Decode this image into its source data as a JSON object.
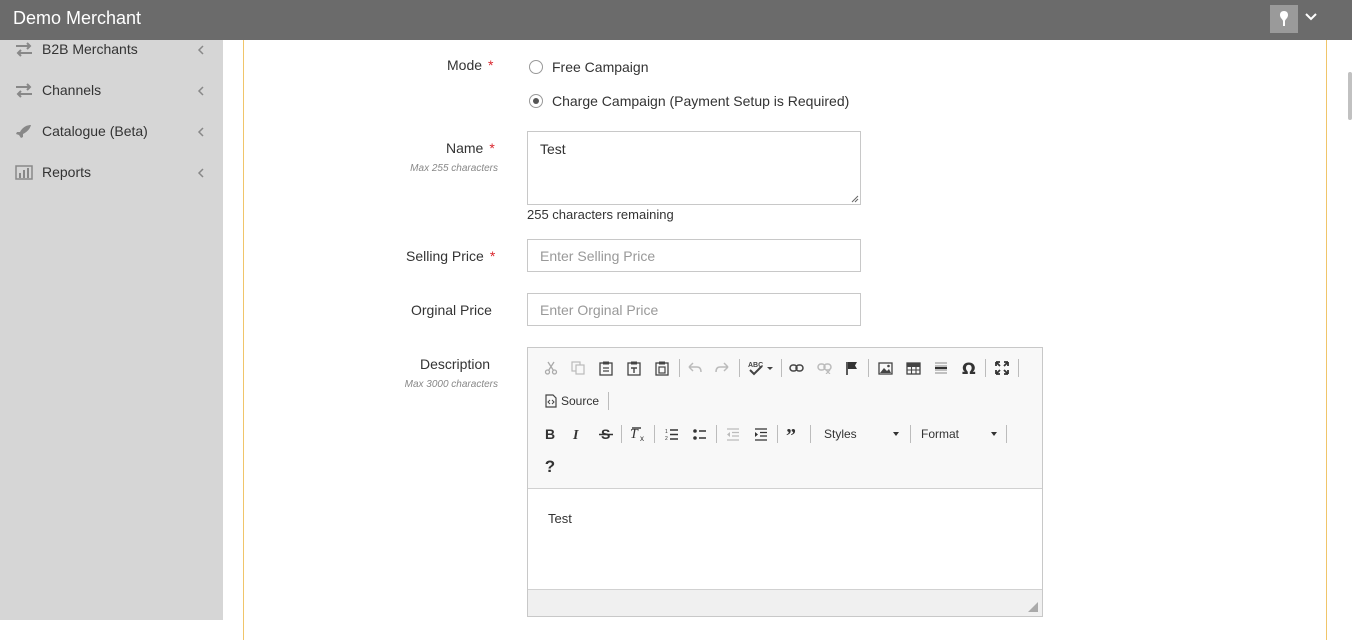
{
  "app": {
    "title": "Demo Merchant"
  },
  "sidebar": {
    "items": [
      {
        "label": "B2B Merchants",
        "icon": "exchange-icon"
      },
      {
        "label": "Channels",
        "icon": "exchange-icon"
      },
      {
        "label": "Catalogue (Beta)",
        "icon": "rocket-icon"
      },
      {
        "label": "Reports",
        "icon": "bar-chart-icon"
      }
    ]
  },
  "form": {
    "mode": {
      "label": "Mode",
      "required_mark": "*",
      "options": [
        {
          "label": "Free Campaign",
          "selected": false
        },
        {
          "label": "Charge Campaign (Payment Setup is Required)",
          "selected": true
        }
      ]
    },
    "name": {
      "label": "Name",
      "required_mark": "*",
      "hint": "Max 255 characters",
      "value": "Test",
      "remaining": "255 characters remaining"
    },
    "selling_price": {
      "label": "Selling Price",
      "required_mark": "*",
      "placeholder": "Enter Selling Price"
    },
    "original_price": {
      "label": "Orginal Price",
      "placeholder": "Enter Orginal Price"
    },
    "description": {
      "label": "Description",
      "hint": "Max 3000 characters",
      "body": "Test",
      "toolbar": {
        "source_label": "Source",
        "styles_label": "Styles",
        "format_label": "Format",
        "help_label": "?"
      }
    }
  },
  "colors": {
    "topbar": "#6b6b6b",
    "sidebar": "#d6d6d6",
    "panel_border": "#f0c56a",
    "required": "#d9262d"
  }
}
